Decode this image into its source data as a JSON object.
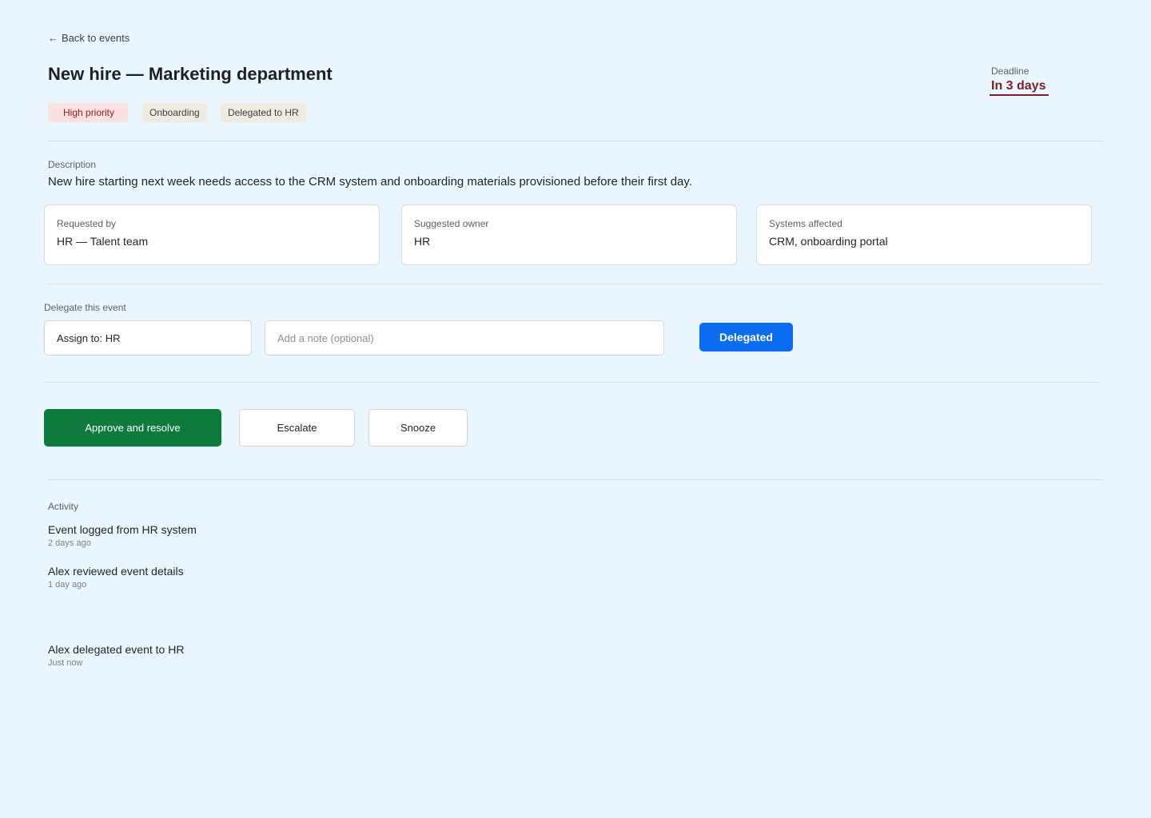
{
  "back_link": {
    "icon": "arrow-left-icon",
    "label": "Back to events"
  },
  "event": {
    "title": "New hire — Marketing department",
    "deadline_label": "Deadline",
    "deadline_value": "In 3 days",
    "tags": [
      "High priority",
      "Onboarding",
      "Delegated to HR"
    ],
    "description_label": "Description",
    "description": "New hire starting next week needs access to the CRM system and onboarding materials provisioned before their first day."
  },
  "cards": [
    {
      "label": "Requested by",
      "value": "HR — Talent team"
    },
    {
      "label": "Suggested owner",
      "value": "HR"
    },
    {
      "label": "Systems affected",
      "value": "CRM, onboarding portal"
    }
  ],
  "delegate": {
    "label": "Delegate this event",
    "assign_value": "Assign to: HR",
    "note_placeholder": "Add a note (optional)",
    "button_label": "Delegated"
  },
  "actions": {
    "approve_label": "Approve and resolve",
    "escalate_label": "Escalate",
    "snooze_label": "Snooze"
  },
  "activity": {
    "label": "Activity",
    "items": [
      {
        "title": "Event logged from HR system",
        "time": "2 days ago"
      },
      {
        "title": "Alex reviewed event details",
        "time": "1 day ago"
      },
      {
        "title": "Alex delegated event to HR",
        "time": "Just now"
      }
    ]
  },
  "colors": {
    "background": "#eaf6fd",
    "deadline": "#7a1f2b",
    "primary_blue": "#0c6cf0",
    "approve_green": "#0e7a3c",
    "high_priority_bg": "#fbe1e2"
  }
}
